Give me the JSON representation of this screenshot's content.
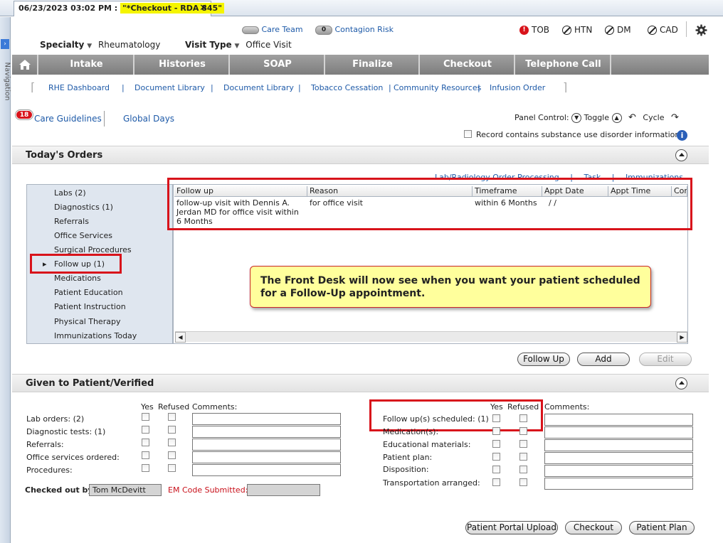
{
  "tab": {
    "datetime": "06/23/2023 03:02 PM :",
    "title": "\"*Checkout - RDA 845\"",
    "close": "✕"
  },
  "nav_label": "Navigation",
  "header": {
    "specialty_label": "Specialty",
    "specialty_value": "Rheumatology",
    "visit_type_label": "Visit Type",
    "visit_type_value": "Office Visit",
    "care_team": "Care Team",
    "contagion_count": "0",
    "contagion_risk": "Contagion Risk",
    "indicators": [
      "TOB",
      "HTN",
      "DM",
      "CAD"
    ]
  },
  "main_tabs": [
    "Intake",
    "Histories",
    "SOAP",
    "Finalize",
    "Checkout",
    "Telephone Call"
  ],
  "sub_links": [
    "RHE Dashboard",
    "Document Library",
    "Document Library",
    "Tobacco Cessation",
    "Community Resources",
    "Infusion Order"
  ],
  "care_guidelines": {
    "badge": "18",
    "label": "Care Guidelines"
  },
  "global_days": "Global Days",
  "panel_control": {
    "label": "Panel Control:",
    "toggle": "Toggle",
    "cycle": "Cycle"
  },
  "substance_label": "Record contains substance use disorder information",
  "orders": {
    "title": "Today's Orders",
    "links": [
      "Lab/Radiology Order Processing",
      "Task",
      "Immunizations"
    ],
    "list": [
      "Labs (2)",
      "Diagnostics (1)",
      "Referrals",
      "Office Services",
      "Surgical Procedures",
      "Follow up (1)",
      "Medications",
      "Patient Education",
      "Patient Instruction",
      "Physical Therapy",
      "Immunizations Today"
    ],
    "columns": [
      "Follow up",
      "Reason",
      "Timeframe",
      "Appt Date",
      "Appt Time",
      "Com"
    ],
    "row": {
      "follow_up": "follow-up visit with Dennis A. Jerdan MD for office visit within 6 Months",
      "reason": "for office visit",
      "timeframe": "within 6 Months",
      "appt_date": "/ /"
    },
    "buttons": [
      "Follow Up",
      "Add",
      "Edit"
    ]
  },
  "callout": "The Front Desk will now see when you want your patient scheduled for a Follow-Up appointment.",
  "given": {
    "title": "Given to Patient/Verified",
    "yes": "Yes",
    "refused": "Refused",
    "comments": "Comments:",
    "left_items": [
      "Lab orders: (2)",
      "Diagnostic tests: (1)",
      "Referrals:",
      "Office services ordered:",
      "Procedures:"
    ],
    "right_items": [
      "Follow up(s) scheduled: (1)",
      "Medication(s):",
      "Educational materials:",
      "Patient plan:",
      "Disposition:",
      "Transportation arranged:"
    ],
    "checked_out_by_label": "Checked out by:",
    "checked_out_by_value": "Tom McDevitt",
    "em_code_label": "EM Code Submitted:"
  },
  "bottom_buttons": [
    "Patient Portal Upload",
    "Checkout",
    "Patient Plan"
  ]
}
